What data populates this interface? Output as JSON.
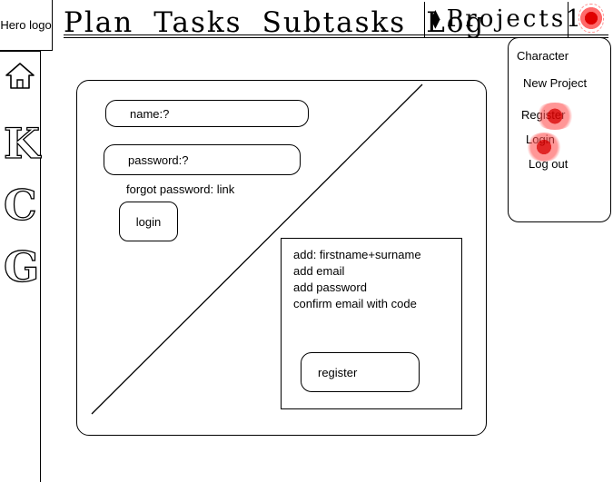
{
  "header": {
    "logo": "Hero logo",
    "nav": [
      "Plan",
      "Tasks",
      "Subtasks",
      "Log"
    ],
    "project_switcher": "Projects1"
  },
  "sidebar": {
    "letters": [
      "K",
      "C",
      "G"
    ]
  },
  "login": {
    "name_label": "name:?",
    "password_label": "password:?",
    "forgot_text": "forgot password: link",
    "login_label": "login"
  },
  "register": {
    "steps": [
      "add: firstname+surname",
      "add email",
      "add password",
      "confirm email with code"
    ],
    "register_label": "register"
  },
  "menu": {
    "items": [
      "Character",
      "New Project",
      "Register",
      "Login",
      "Log out"
    ]
  },
  "icons": {
    "home": "home-icon",
    "switcher": "up-down-arrows-icon",
    "avatar": "avatar-icon"
  },
  "colors": {
    "scribble": "#e00000"
  }
}
